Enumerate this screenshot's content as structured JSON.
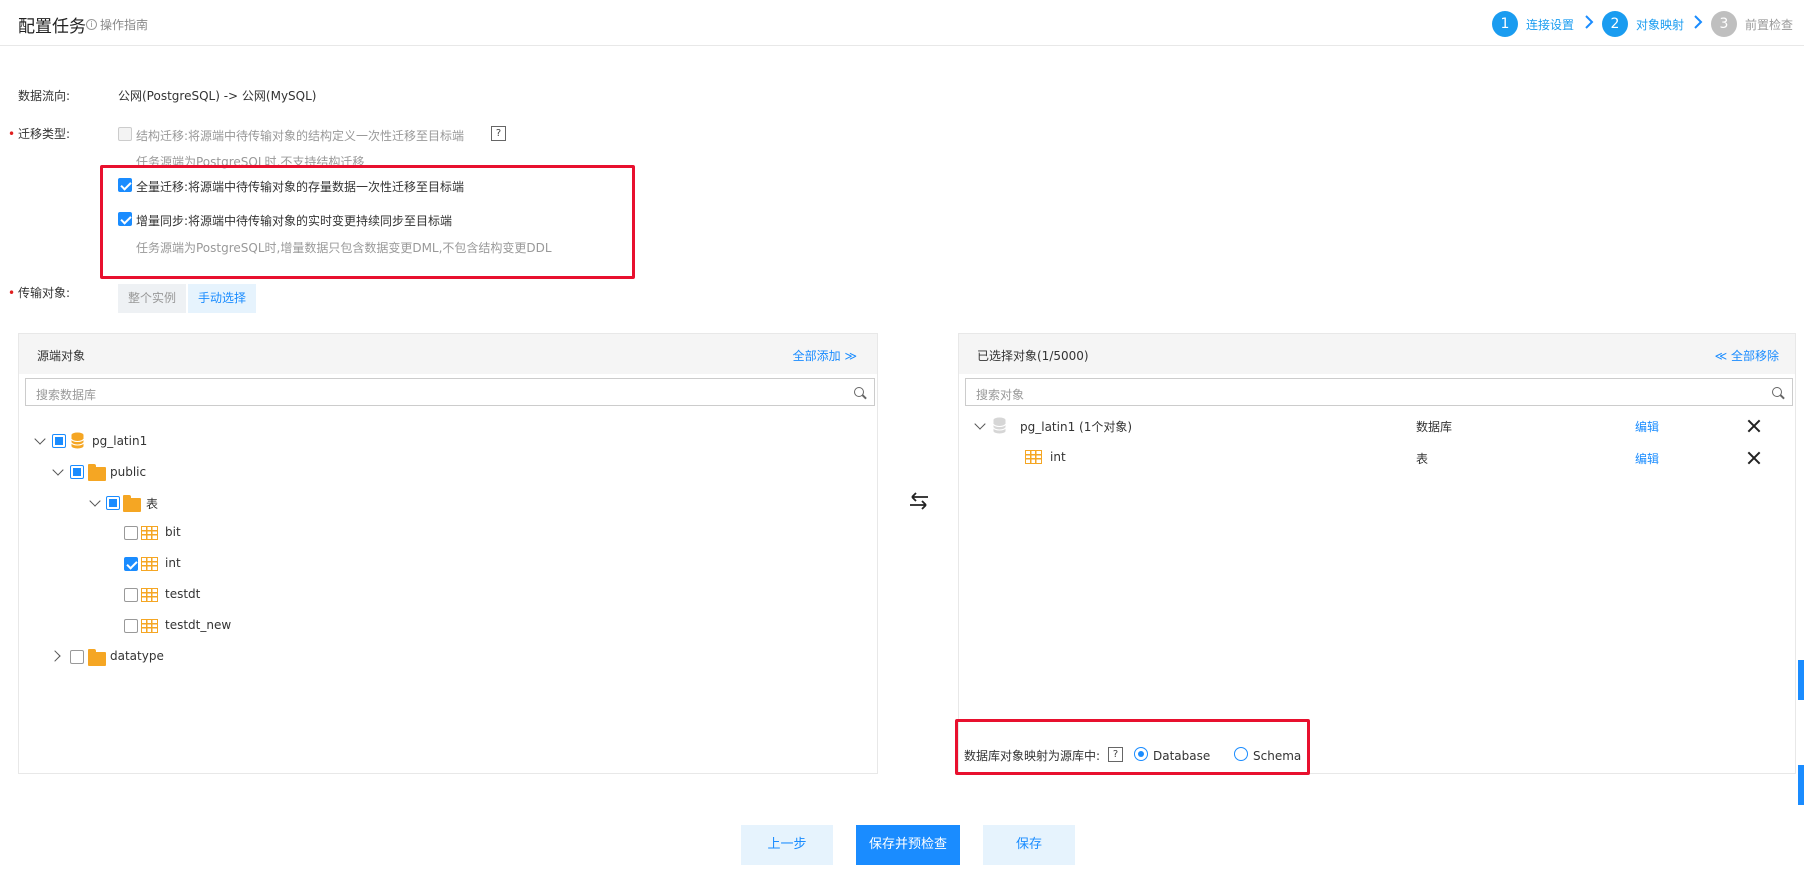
{
  "header": {
    "title": "配置任务",
    "guide_label": "操作指南",
    "steps": [
      {
        "num": "1",
        "label": "连接设置",
        "state": "active"
      },
      {
        "num": "2",
        "label": "对象映射",
        "state": "active"
      },
      {
        "num": "3",
        "label": "前置检查",
        "state": "inactive"
      }
    ]
  },
  "form": {
    "data_flow_label": "数据流向:",
    "data_flow_value": "公网(PostgreSQL) -> 公网(MySQL)",
    "migration_type_label": "迁移类型:",
    "options": {
      "structure": {
        "label": "结构迁移:将源端中待传输对象的结构定义一次性迁移至目标端",
        "hint": "任务源端为PostgreSQL时,不支持结构迁移",
        "checked": false,
        "disabled": true
      },
      "full": {
        "label": "全量迁移:将源端中待传输对象的存量数据一次性迁移至目标端",
        "checked": true
      },
      "incremental": {
        "label": "增量同步:将源端中待传输对象的实时变更持续同步至目标端",
        "hint": "任务源端为PostgreSQL时,增量数据只包含数据变更DML,不包含结构变更DDL",
        "checked": true
      }
    },
    "help_mark": "?",
    "transfer_object_label": "传输对象:",
    "mode_buttons": {
      "whole": "整个实例",
      "manual": "手动选择"
    }
  },
  "source_panel": {
    "title": "源端对象",
    "add_all": "全部添加",
    "search_placeholder": "搜索数据库",
    "tree": {
      "db": "pg_latin1",
      "schema": "public",
      "group": "表",
      "tables": [
        {
          "name": "bit",
          "checked": false
        },
        {
          "name": "int",
          "checked": true
        },
        {
          "name": "testdt",
          "checked": false
        },
        {
          "name": "testdt_new",
          "checked": false
        }
      ],
      "other_schema": "datatype"
    }
  },
  "target_panel": {
    "title": "已选择对象(1/5000)",
    "remove_all": "全部移除",
    "search_placeholder": "搜索对象",
    "rows": [
      {
        "name": "pg_latin1 (1个对象)",
        "type": "数据库",
        "action": "编辑"
      },
      {
        "name": "int",
        "type": "表",
        "action": "编辑"
      }
    ],
    "mapping_label": "数据库对象映射为源库中:",
    "mapping_options": [
      {
        "label": "Database",
        "selected": true
      },
      {
        "label": "Schema",
        "selected": false
      }
    ]
  },
  "footer": {
    "prev": "上一步",
    "save_and_check": "保存并预检查",
    "save": "保存"
  },
  "colors": {
    "accent": "#1a8cff",
    "highlight_box": "#e8102e",
    "folder": "#f5a623"
  }
}
